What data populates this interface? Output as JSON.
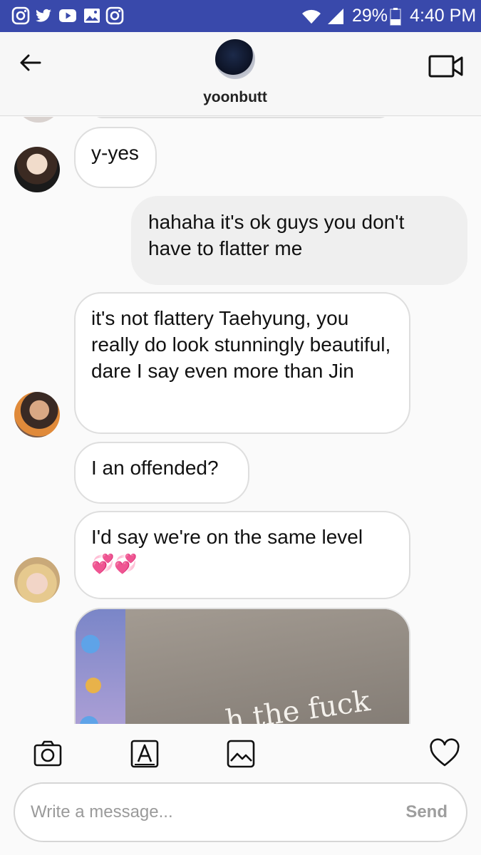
{
  "status_bar": {
    "battery": "29%",
    "time": "4:40 PM",
    "left_icons": [
      "instagram-icon",
      "twitter-icon",
      "youtube-icon",
      "gallery-icon",
      "instagram-icon"
    ],
    "right_icons": [
      "wifi-icon",
      "signal-icon",
      "battery-icon"
    ]
  },
  "header": {
    "username": "yoonbutt",
    "back_icon": "arrow-left-icon",
    "video_icon": "video-camera-icon"
  },
  "messages": [
    {
      "sender": "other",
      "text": "y-yes"
    },
    {
      "sender": "me",
      "text": "hahaha it's ok guys you don't have to flatter me"
    },
    {
      "sender": "other",
      "text": "it's not flattery Taehyung, you really do look stunningly beautiful, dare I say even more than Jin"
    },
    {
      "sender": "other",
      "text": "I an offended?"
    },
    {
      "sender": "other",
      "text": "I'd say we're on the same level",
      "emoji": "💞💞"
    },
    {
      "sender": "other",
      "type": "photo",
      "caption": "h the fuck"
    }
  ],
  "toolbar": {
    "icons": [
      "camera-icon",
      "sticker-icon",
      "gallery-icon",
      "heart-icon"
    ]
  },
  "composer": {
    "placeholder": "Write a message...",
    "send_label": "Send"
  },
  "colors": {
    "status_bar": "#3949ab",
    "bubble_border": "#dedede",
    "outgoing_bubble": "#efefef"
  }
}
